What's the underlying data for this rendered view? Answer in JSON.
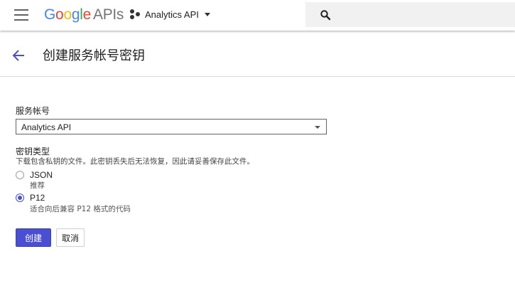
{
  "topbar": {
    "logo_google_letters": [
      {
        "char": "G",
        "color": "#4285F4"
      },
      {
        "char": "o",
        "color": "#EA4335"
      },
      {
        "char": "o",
        "color": "#FBBC05"
      },
      {
        "char": "g",
        "color": "#4285F4"
      },
      {
        "char": "l",
        "color": "#34A853"
      },
      {
        "char": "e",
        "color": "#EA4335"
      }
    ],
    "logo_apis": "APIs",
    "project_name": "Analytics API",
    "search_placeholder": ""
  },
  "header": {
    "title": "创建服务帐号密钥"
  },
  "form": {
    "service_account_label": "服务帐号",
    "service_account_value": "Analytics API",
    "key_type_label": "密钥类型",
    "key_type_hint": "下载包含私钥的文件。此密钥丢失后无法恢复，因此请妥善保存此文件。",
    "options": [
      {
        "label": "JSON",
        "description": "推荐",
        "checked": false
      },
      {
        "label": "P12",
        "description": "适合向后兼容 P12 格式的代码",
        "checked": true
      }
    ],
    "create_button": "创建",
    "cancel_button": "取消"
  },
  "colors": {
    "accent": "#4a4fd1",
    "radio_checked": "#4a4fc9"
  }
}
